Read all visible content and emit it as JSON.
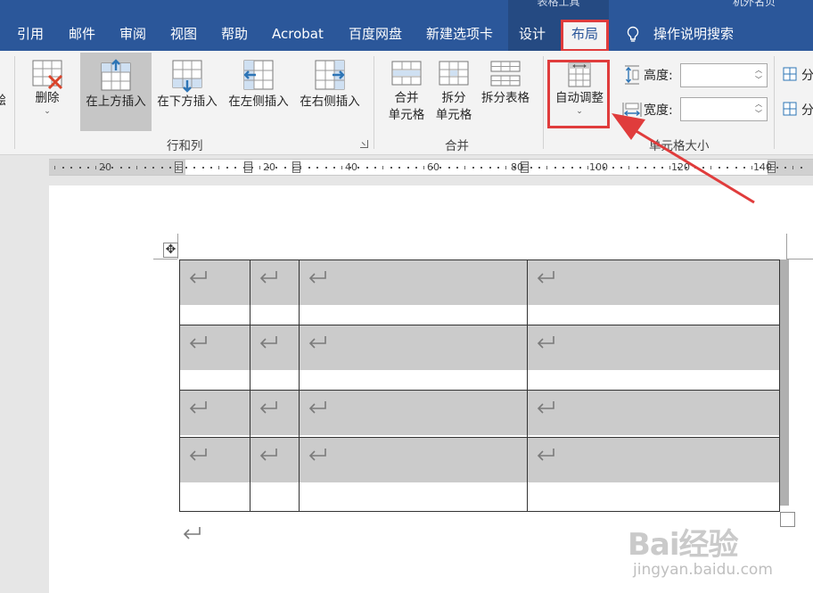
{
  "tabs": {
    "context_label": "表格工具",
    "top_right": "机外名贝",
    "items": [
      "引用",
      "邮件",
      "审阅",
      "视图",
      "帮助",
      "Acrobat",
      "百度网盘",
      "新建选项卡",
      "设计",
      "布局"
    ],
    "active": "布局",
    "tell_me": "操作说明搜索"
  },
  "ribbon": {
    "delete_label": "删除",
    "insert_above": "在上方插入",
    "insert_below": "在下方插入",
    "insert_left": "在左侧插入",
    "insert_right": "在右侧插入",
    "rows_cols_group": "行和列",
    "merge_cells_1": "合并",
    "merge_cells_2": "单元格",
    "split_cells_1": "拆分",
    "split_cells_2": "单元格",
    "split_table": "拆分表格",
    "merge_group": "合并",
    "autofit": "自动调整",
    "height_label": "高度:",
    "width_label": "宽度:",
    "height_value": "",
    "width_value": "",
    "cell_size_group": "单元格大小",
    "distribute_1": "分",
    "distribute_2": "分",
    "left_cut": "绘"
  },
  "ruler": {
    "numbers": [
      "20",
      "20",
      "40",
      "60",
      "80",
      "100",
      "120",
      "140"
    ]
  },
  "document": {
    "table": {
      "rows": 4,
      "cols": 4
    }
  },
  "watermark": {
    "brand": "Bai经验",
    "url": "jingyan.baidu.com"
  },
  "colors": {
    "tab_bar": "#2b579a",
    "ribbon": "#f3f3f3",
    "highlight_box": "#e03c3c",
    "cell_shading": "#cbcbcb"
  }
}
